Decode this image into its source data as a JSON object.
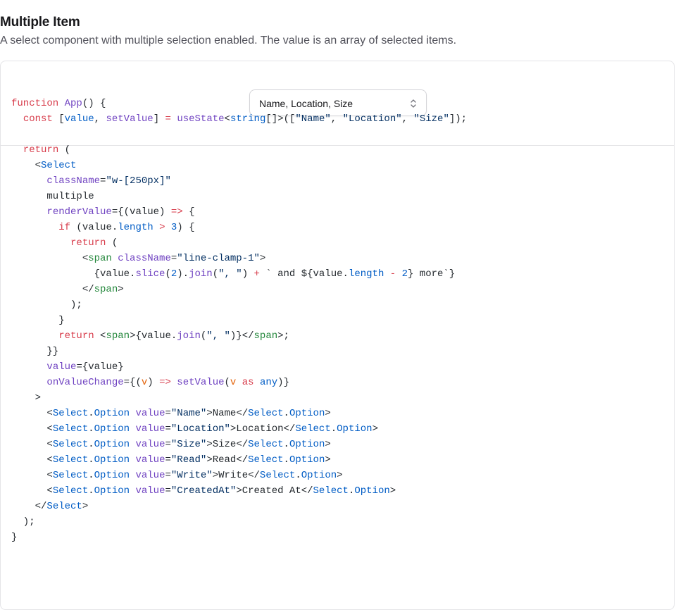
{
  "section": {
    "title": "Multiple Item",
    "description": "A select component with multiple selection enabled. The value is an array of selected items."
  },
  "preview": {
    "select_value": "Name, Location, Size",
    "icon": "chevron-up-down-icon"
  },
  "code": {
    "language": "tsx",
    "lines": [
      "function App() {",
      "  const [value, setValue] = useState<string[]>([\"Name\", \"Location\", \"Size\"]);",
      "",
      "  return (",
      "    <Select",
      "      className=\"w-[250px]\"",
      "      multiple",
      "      renderValue={(value) => {",
      "        if (value.length > 3) {",
      "          return (",
      "            <span className=\"line-clamp-1\">",
      "              {value.slice(2).join(\", \") + ` and ${value.length - 2} more`}",
      "            </span>",
      "          );",
      "        }",
      "        return <span>{value.join(\", \")}</span>;",
      "      }}",
      "      value={value}",
      "      onValueChange={(v) => setValue(v as any)}",
      "    >",
      "      <Select.Option value=\"Name\">Name</Select.Option>",
      "      <Select.Option value=\"Location\">Location</Select.Option>",
      "      <Select.Option value=\"Size\">Size</Select.Option>",
      "      <Select.Option value=\"Read\">Read</Select.Option>",
      "      <Select.Option value=\"Write\">Write</Select.Option>",
      "      <Select.Option value=\"CreatedAt\">Created At</Select.Option>",
      "    </Select>",
      "  );",
      "}"
    ]
  },
  "colors": {
    "keyword": "#d73a49",
    "function": "#6f42c1",
    "tag": "#22863a",
    "string": "#032f62",
    "constant": "#005cc5",
    "parameter": "#e36209"
  }
}
